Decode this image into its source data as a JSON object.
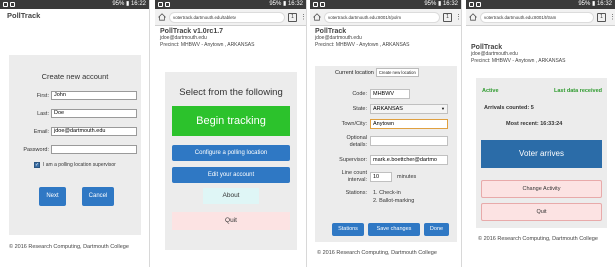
{
  "statusbar": {
    "panel1": {
      "right": "95% ▮ 16:22"
    },
    "panel2": {
      "right": "95% ▮ 16:32"
    },
    "panel3": {
      "right": "95% ▮ 16:32"
    },
    "panel4": {
      "right": "95% ▮ 16:32"
    }
  },
  "browser": {
    "url2": "votertrack.dartmouth.edu/tabletv",
    "url3": "votertrack.dartmouth.edu:8001/t/polm",
    "url4": "votertrack.dartmouth.edu:8001/t/tram",
    "tabs_count": "1"
  },
  "panel1": {
    "app_title": "PollTrack",
    "heading": "Create new account",
    "fields": [
      {
        "label": "First:",
        "value": "John"
      },
      {
        "label": "Last:",
        "value": "Doe"
      },
      {
        "label": "Email:",
        "value": "jdoe@dartmouth.edu"
      },
      {
        "label": "Password:",
        "value": ""
      }
    ],
    "supervisor_label": "I am a polling location supervisor",
    "next_label": "Next",
    "cancel_label": "Cancel",
    "footer": "© 2016 Research Computing, Dartmouth College"
  },
  "panel2": {
    "app_title": "PollTrack v1.0rc1.7",
    "email": "jdoe@dartmouth.edu",
    "precinct": "Precinct: MHBWV - Anytown , ARKANSAS",
    "heading": "Select from the following",
    "begin_label": "Begin tracking",
    "configure_label": "Configure a polling location",
    "edit_label": "Edit your account",
    "about_label": "About",
    "quit_label": "Quit"
  },
  "panel3": {
    "app_title": "PollTrack",
    "email": "jdoe@dartmouth.edu",
    "precinct": "Precinct: MHBWV - Anytown , ARKANSAS",
    "current_location_label": "Current location",
    "create_location_label": "Create new location",
    "code_label": "Code:",
    "code_value": "MHBWV",
    "state_label": "State:",
    "state_value": "ARKANSAS",
    "town_label": "Town/City:",
    "town_value": "Anytown",
    "optional_label": "Optional details:",
    "supervisor_label": "Supervisor:",
    "supervisor_value": "mark.e.boettcher@dartmo",
    "line_count_label": "Line count interval:",
    "line_count_value": "10",
    "minutes_label": "minutes",
    "stations_label": "Stations:",
    "stations": [
      "1. Check-in",
      "2. Ballot-marking"
    ],
    "stations_button": "Stations",
    "save_button": "Save changes",
    "done_button": "Done",
    "footer": "© 2016 Research Computing, Dartmouth College"
  },
  "panel4": {
    "app_title": "PollTrack",
    "email": "jdoe@dartmouth.edu",
    "precinct": "Precinct: MHBWV - Anytown , ARKANSAS",
    "active_label": "Active",
    "last_data_label": "Last data received",
    "arrivals_label": "Arrivals counted:",
    "arrivals_value": "5",
    "recent_label": "Most recent:",
    "recent_value": "16:33:24",
    "voter_arrives_label": "Voter arrives",
    "change_activity_label": "Change Activity",
    "quit_label": "Quit",
    "footer": "© 2016 Research Computing, Dartmouth College"
  },
  "colors": {
    "begin_green": "#2cc22c",
    "primary_blue": "#2f78c4",
    "voter_blue": "#2b6ca8",
    "active_green": "#2d9a2d",
    "quit_pink": "#fce3e3"
  }
}
